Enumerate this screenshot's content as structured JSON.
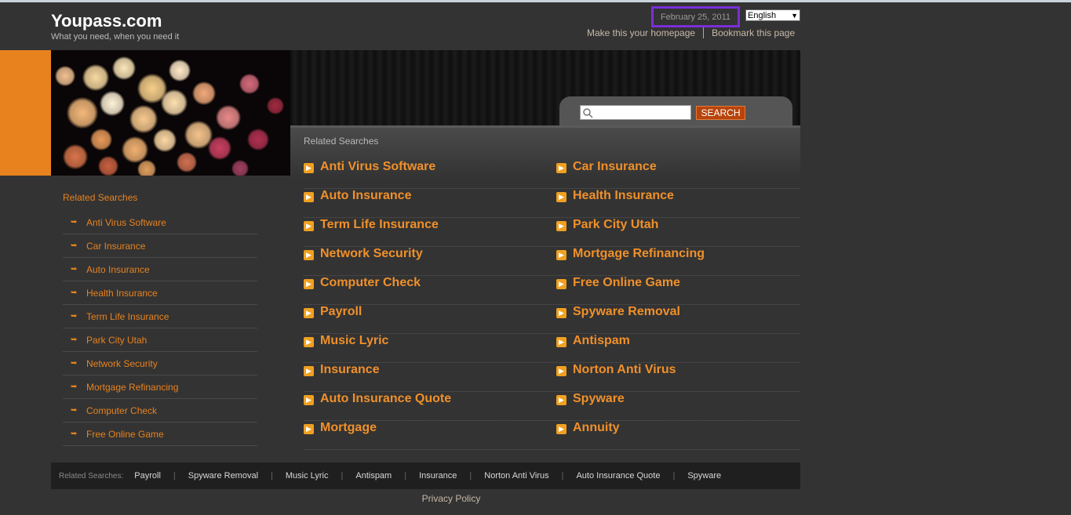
{
  "site": {
    "title": "Youpass.com",
    "tagline": "What you need, when you need it"
  },
  "header": {
    "date": "February 25, 2011",
    "language": "English",
    "homepage_link": "Make this your homepage",
    "bookmark_link": "Bookmark this page"
  },
  "search": {
    "button_label": "SEARCH",
    "value": ""
  },
  "main": {
    "heading": "Related Searches",
    "left_items": [
      "Anti Virus Software",
      "Auto Insurance",
      "Term Life Insurance",
      "Network Security",
      "Computer Check",
      "Payroll",
      "Music Lyric",
      "Insurance",
      "Auto Insurance Quote",
      "Mortgage"
    ],
    "right_items": [
      "Car Insurance",
      "Health Insurance",
      "Park City Utah",
      "Mortgage Refinancing",
      "Free Online Game",
      "Spyware Removal",
      "Antispam",
      "Norton Anti Virus",
      "Spyware",
      "Annuity"
    ]
  },
  "sidebar": {
    "heading": "Related Searches",
    "items": [
      "Anti Virus Software",
      "Car Insurance",
      "Auto Insurance",
      "Health Insurance",
      "Term Life Insurance",
      "Park City Utah",
      "Network Security",
      "Mortgage Refinancing",
      "Computer Check",
      "Free Online Game"
    ]
  },
  "footer": {
    "label": "Related Searches:",
    "items": [
      "Payroll",
      "Spyware Removal",
      "Music Lyric",
      "Antispam",
      "Insurance",
      "Norton Anti Virus",
      "Auto Insurance Quote",
      "Spyware"
    ],
    "privacy": "Privacy Policy"
  },
  "colors": {
    "accent": "#e8821e",
    "link": "#f0902a",
    "background": "#333333",
    "date_highlight": "#7a2fd6"
  }
}
